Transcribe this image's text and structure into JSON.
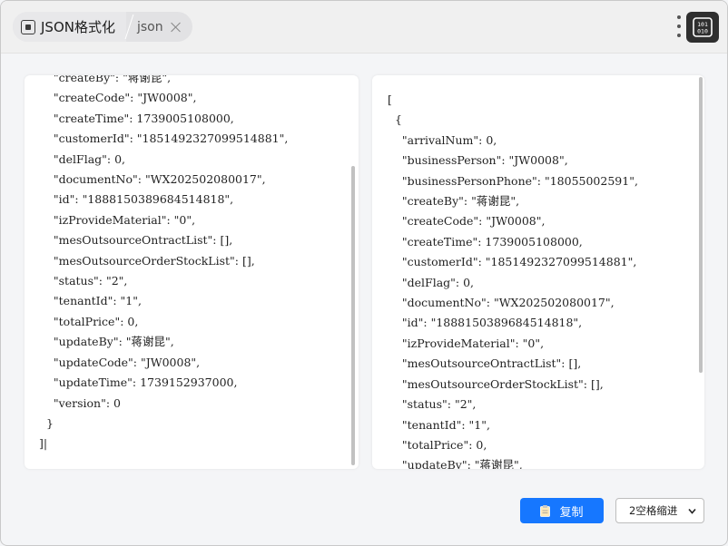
{
  "titlebar": {
    "tab_active_label": "JSON格式化",
    "tab_second_label": "json"
  },
  "left_panel": {
    "lines": [
      "    \"createBy\": \"蒋谢昆\",",
      "    \"createCode\": \"JW0008\",",
      "    \"createTime\": 1739005108000,",
      "    \"customerId\": \"1851492327099514881\",",
      "    \"delFlag\": 0,",
      "    \"documentNo\": \"WX202502080017\",",
      "    \"id\": \"1888150389684514818\",",
      "    \"izProvideMaterial\": \"0\",",
      "    \"mesOutsourceOntractList\": [],",
      "    \"mesOutsourceOrderStockList\": [],",
      "    \"status\": \"2\",",
      "    \"tenantId\": \"1\",",
      "    \"totalPrice\": 0,",
      "    \"updateBy\": \"蒋谢昆\",",
      "    \"updateCode\": \"JW0008\",",
      "    \"updateTime\": 1739152937000,",
      "    \"version\": 0",
      "  }",
      "]|"
    ]
  },
  "right_panel": {
    "lines": [
      "[",
      "  {",
      "    \"arrivalNum\": 0,",
      "    \"businessPerson\": \"JW0008\",",
      "    \"businessPersonPhone\": \"18055002591\",",
      "    \"createBy\": \"蒋谢昆\",",
      "    \"createCode\": \"JW0008\",",
      "    \"createTime\": 1739005108000,",
      "    \"customerId\": \"1851492327099514881\",",
      "    \"delFlag\": 0,",
      "    \"documentNo\": \"WX202502080017\",",
      "    \"id\": \"1888150389684514818\",",
      "    \"izProvideMaterial\": \"0\",",
      "    \"mesOutsourceOntractList\": [],",
      "    \"mesOutsourceOrderStockList\": [],",
      "    \"status\": \"2\",",
      "    \"tenantId\": \"1\",",
      "    \"totalPrice\": 0,",
      "    \"updateBy\": \"蒋谢昆\","
    ]
  },
  "footer": {
    "copy_label": "复制",
    "indent_selected": "2空格缩进"
  },
  "colors": {
    "accent": "#1677ff",
    "toolbox_bg": "#2f2f2f"
  }
}
